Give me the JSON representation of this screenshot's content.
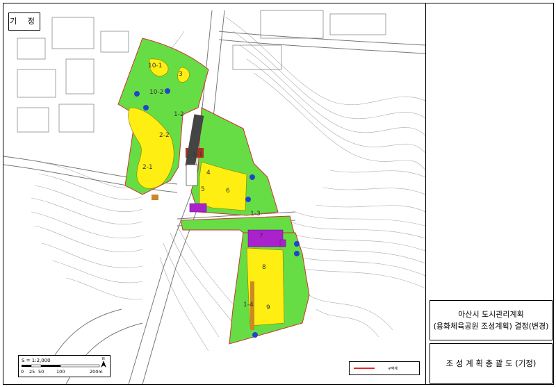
{
  "tag_label": "기 정",
  "title": {
    "line1": "아산시 도시관리계획",
    "line2": "(용화체육공원 조성계획) 결정(변경)"
  },
  "subtitle": "조 성 계 획 총 괄 도 (기정)",
  "scale": {
    "text": "S = 1:2,000",
    "ticks": [
      "0",
      "25",
      "50",
      "100",
      "200m"
    ],
    "north_label": "N"
  },
  "legend": {
    "label": "구역계"
  },
  "parcel_labels": [
    "10-1",
    "10-2",
    "3",
    "1-2",
    "2-2",
    "2-1",
    "1-1",
    "4",
    "5",
    "6",
    "1-3",
    "7",
    "8",
    "1-4",
    "9"
  ],
  "colors": {
    "park": "#66dd44",
    "facility": "#ffee11",
    "building": "#aa22cc",
    "road": "#ee2222",
    "plaza": "#cc8822",
    "topo": "#9a9a9a"
  }
}
